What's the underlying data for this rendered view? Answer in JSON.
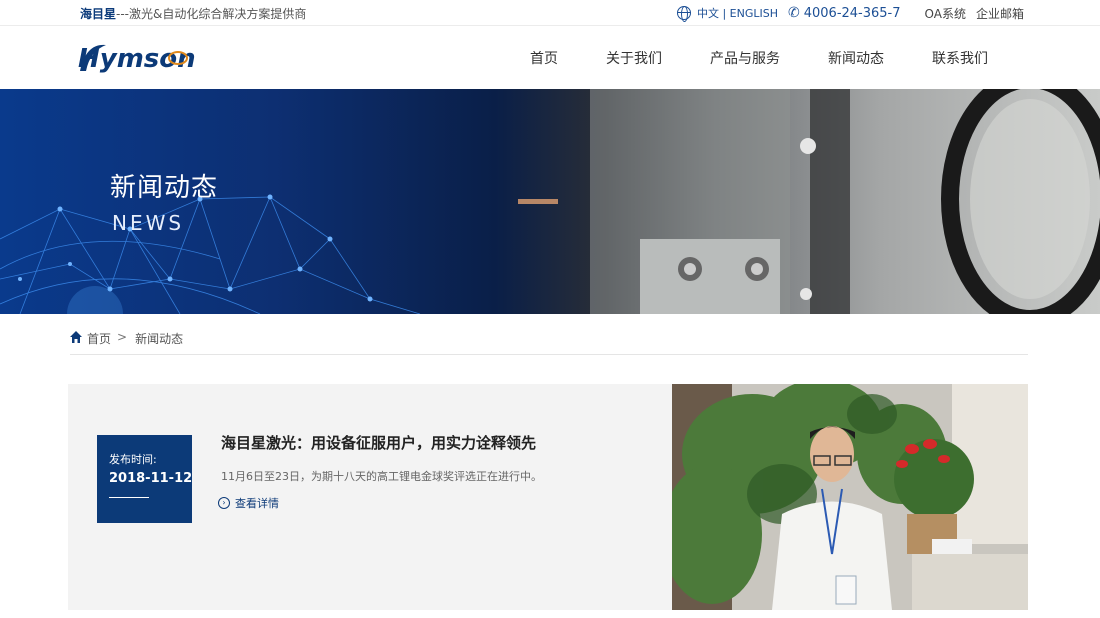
{
  "topbar": {
    "brand": "海目星",
    "tagline": "---激光&自动化综合解决方案提供商",
    "lang": "中文 | ENGLISH",
    "phone": "4006-24-365-7",
    "links": [
      "OA系统",
      "企业邮箱"
    ]
  },
  "header": {
    "logo_text": "Hymson",
    "nav": [
      "首页",
      "关于我们",
      "产品与服务",
      "新闻动态",
      "联系我们"
    ]
  },
  "banner": {
    "title": "新闻动态",
    "subtitle": "NEWS"
  },
  "breadcrumb": {
    "items": [
      "首页",
      "新闻动态"
    ],
    "separator": ">"
  },
  "news": {
    "date_label": "发布时间:",
    "date": "2018-11-12",
    "title": "海目星激光：用设备征服用户，用实力诠释领先",
    "summary": "11月6日至23日，为期十八天的高工锂电金球奖评选正在进行中。",
    "more_label": "查看详情"
  },
  "colors": {
    "brand_blue": "#0c3a78",
    "accent_blue": "#1c4f95",
    "card_bg": "#f3f3f3"
  },
  "icons": [
    "globe-icon",
    "phone-icon",
    "home-icon",
    "circle-arrow-icon"
  ]
}
